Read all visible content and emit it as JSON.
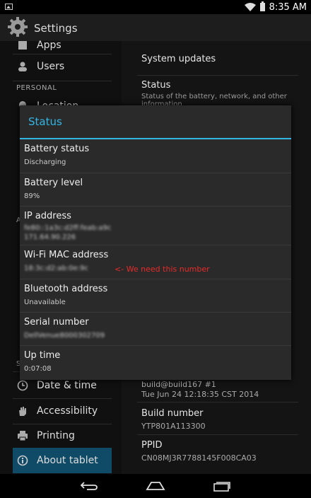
{
  "status_bar": {
    "time": "8:35 AM",
    "icons": [
      "image-icon",
      "wifi-icon",
      "battery-icon"
    ]
  },
  "action_bar": {
    "title": "Settings",
    "icon": "gear-icon"
  },
  "left_pane": {
    "items": [
      {
        "label": "Apps",
        "icon": "apps-icon"
      },
      {
        "label": "Users",
        "icon": "user-icon"
      },
      {
        "label": "Location",
        "icon": "location-icon"
      },
      {
        "label": "Date & time",
        "icon": "clock-icon"
      },
      {
        "label": "Accessibility",
        "icon": "hand-icon"
      },
      {
        "label": "Printing",
        "icon": "printer-icon"
      },
      {
        "label": "About tablet",
        "icon": "info-icon"
      }
    ],
    "headers": [
      "PERSONAL",
      "A",
      "S"
    ]
  },
  "right_pane": {
    "items": [
      {
        "title": "System updates"
      },
      {
        "title": "Status",
        "subtitle": "Status of the battery, network, and other information"
      },
      {
        "title": "build@build167 #1",
        "subtitle": "Tue Jun 24 12:18:35 CST 2014"
      },
      {
        "title": "Build number",
        "subtitle": "YTP801A113300"
      },
      {
        "title": "PPID",
        "subtitle": "CN08MJ3R7788145F008CA03"
      }
    ]
  },
  "dialog": {
    "title": "Status",
    "rows": [
      {
        "label": "Battery status",
        "value": "Discharging"
      },
      {
        "label": "Battery level",
        "value": "89%"
      },
      {
        "label": "IP address",
        "value": "fe80::1a3c:d2ff:feab:a9c",
        "value2": "171.64.90.226"
      },
      {
        "label": "Wi-Fi MAC address",
        "value": "18:3c:d2:ab:0e:9c"
      },
      {
        "label": "Bluetooth address",
        "value": "Unavailable"
      },
      {
        "label": "Serial number",
        "value": "DellVenue8000302709"
      },
      {
        "label": "Up time",
        "value": "0:07:08"
      }
    ],
    "annotation": "<- We need this number",
    "accent": "#33b5e5",
    "annotation_color": "#e82a2a"
  },
  "nav_bar": {
    "buttons": [
      "back-icon",
      "home-icon",
      "recents-icon"
    ]
  }
}
